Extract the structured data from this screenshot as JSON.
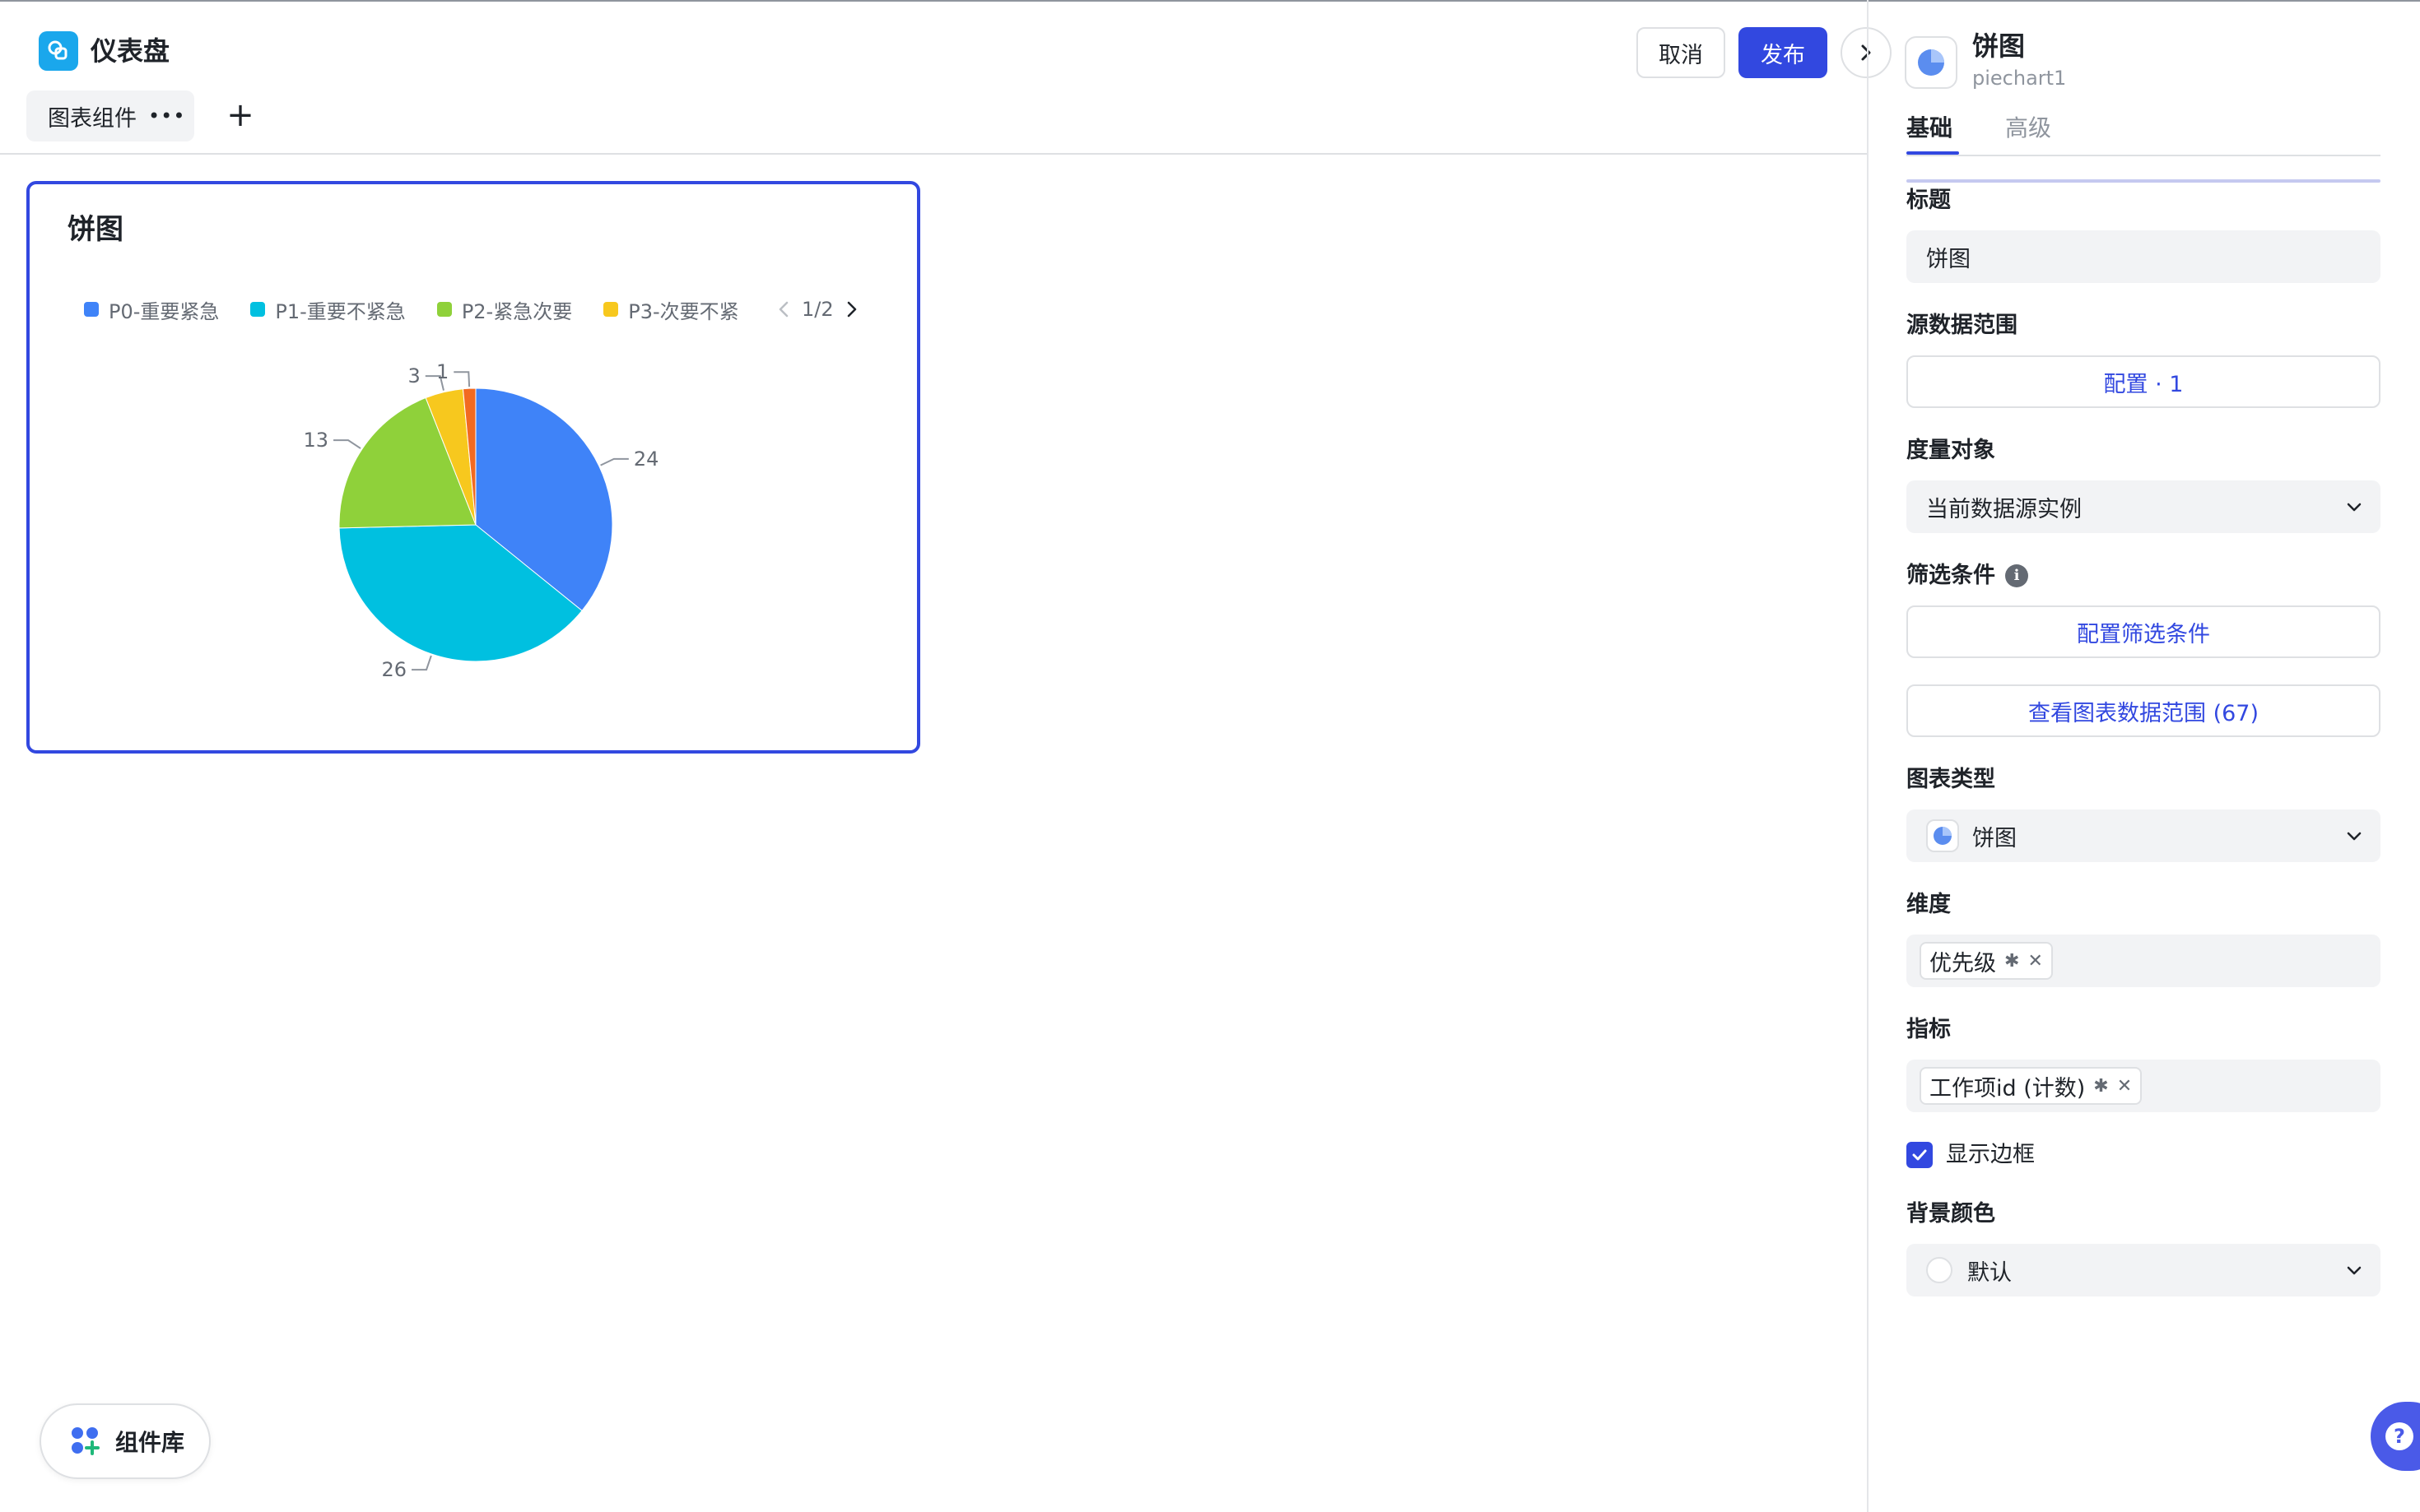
{
  "app": {
    "title": "仪表盘"
  },
  "tabs": [
    {
      "label": "图表组件",
      "more": "•••"
    }
  ],
  "add_tab_symbol": "+",
  "toolbar": {
    "cancel_label": "取消",
    "publish_label": "发布"
  },
  "card": {
    "title": "饼图",
    "legend": [
      {
        "label": "P0-重要紧急",
        "color": "#3f83f8"
      },
      {
        "label": "P1-重要不紧急",
        "color": "#00c0e0"
      },
      {
        "label": "P2-紧急次要",
        "color": "#8fd13a"
      },
      {
        "label": "P3-次要不紧",
        "color": "#f7c81e"
      }
    ],
    "legend_page": "1/2"
  },
  "chart_data": {
    "type": "pie",
    "slices": [
      {
        "value": 24,
        "color": "#3f83f8"
      },
      {
        "value": 26,
        "color": "#00c0e0"
      },
      {
        "value": 13,
        "color": "#8fd13a"
      },
      {
        "value": 3,
        "color": "#f7c81e"
      },
      {
        "value": 1,
        "color": "#f26a21"
      }
    ],
    "data_labels": [
      "24",
      "26",
      "13",
      "3",
      "1"
    ],
    "legend_placement": "top"
  },
  "panel": {
    "title": "饼图",
    "subtitle": "piechart1",
    "tabs": {
      "basic": "基础",
      "advanced": "高级"
    },
    "fields": {
      "title_label": "标题",
      "title_value": "饼图",
      "source_label": "源数据范围",
      "source_button": "配置 · 1",
      "measure_label": "度量对象",
      "measure_value": "当前数据源实例",
      "filter_label": "筛选条件",
      "filter_button": "配置筛选条件",
      "view_range_button": "查看图表数据范围 (67)",
      "chart_type_label": "图表类型",
      "chart_type_value": "饼图",
      "dimension_label": "维度",
      "dimension_tag": "优先级",
      "metric_label": "指标",
      "metric_tag": "工作项id (计数)",
      "show_border_label": "显示边框",
      "show_border_checked": true,
      "bg_color_label": "背景颜色",
      "bg_color_value": "默认"
    }
  },
  "bottom": {
    "library_label": "组件库"
  },
  "colors": {
    "accent": "#3248e0",
    "app_icon": "#1aa7ec"
  }
}
